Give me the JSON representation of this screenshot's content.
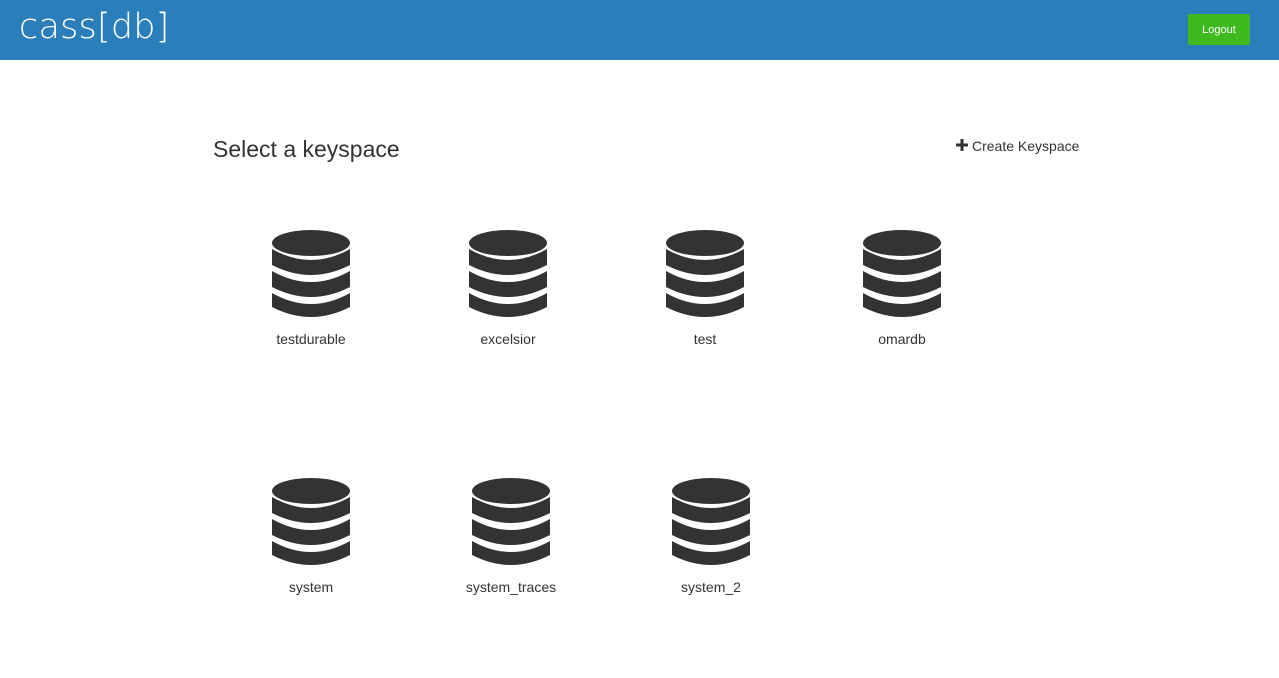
{
  "header": {
    "brand": "cass[db]",
    "logout_label": "Logout",
    "bg_color": "#2a7fba",
    "logout_color": "#3fba1e"
  },
  "main": {
    "title": "Select a keyspace",
    "create_label": "Create Keyspace",
    "keyspaces": [
      {
        "name": "testdurable"
      },
      {
        "name": "excelsior"
      },
      {
        "name": "test"
      },
      {
        "name": "omardb"
      },
      {
        "name": "system"
      },
      {
        "name": "system_traces"
      },
      {
        "name": "system_2"
      }
    ],
    "icon": "database-icon"
  }
}
